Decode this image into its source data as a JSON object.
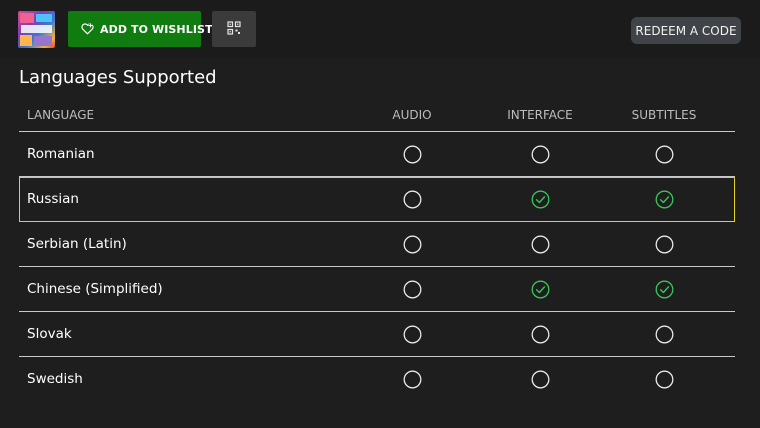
{
  "topbar": {
    "wishlist_label": "ADD TO WISHLIST",
    "redeem_label": "REDEEM A CODE"
  },
  "section": {
    "title": "Languages Supported"
  },
  "table": {
    "headers": {
      "language": "LANGUAGE",
      "audio": "AUDIO",
      "interface": "INTERFACE",
      "subtitles": "SUBTITLES"
    },
    "rows": [
      {
        "language": "Romanian",
        "audio": false,
        "interface": false,
        "subtitles": false,
        "focused": false
      },
      {
        "language": "Russian",
        "audio": false,
        "interface": true,
        "subtitles": true,
        "focused": true
      },
      {
        "language": "Serbian (Latin)",
        "audio": false,
        "interface": false,
        "subtitles": false,
        "focused": false
      },
      {
        "language": "Chinese (Simplified)",
        "audio": false,
        "interface": true,
        "subtitles": true,
        "focused": false
      },
      {
        "language": "Slovak",
        "audio": false,
        "interface": false,
        "subtitles": false,
        "focused": false
      },
      {
        "language": "Swedish",
        "audio": false,
        "interface": false,
        "subtitles": false,
        "focused": false
      }
    ]
  },
  "icons": {
    "wishlist": "heart-plus-icon",
    "qr": "qr-code-icon",
    "supported": "check-circle-icon",
    "unsupported": "empty-circle-icon"
  },
  "colors": {
    "accent_green": "#107c10",
    "check_green": "#3cc35b",
    "focus_yellow": "#e3d21a"
  }
}
